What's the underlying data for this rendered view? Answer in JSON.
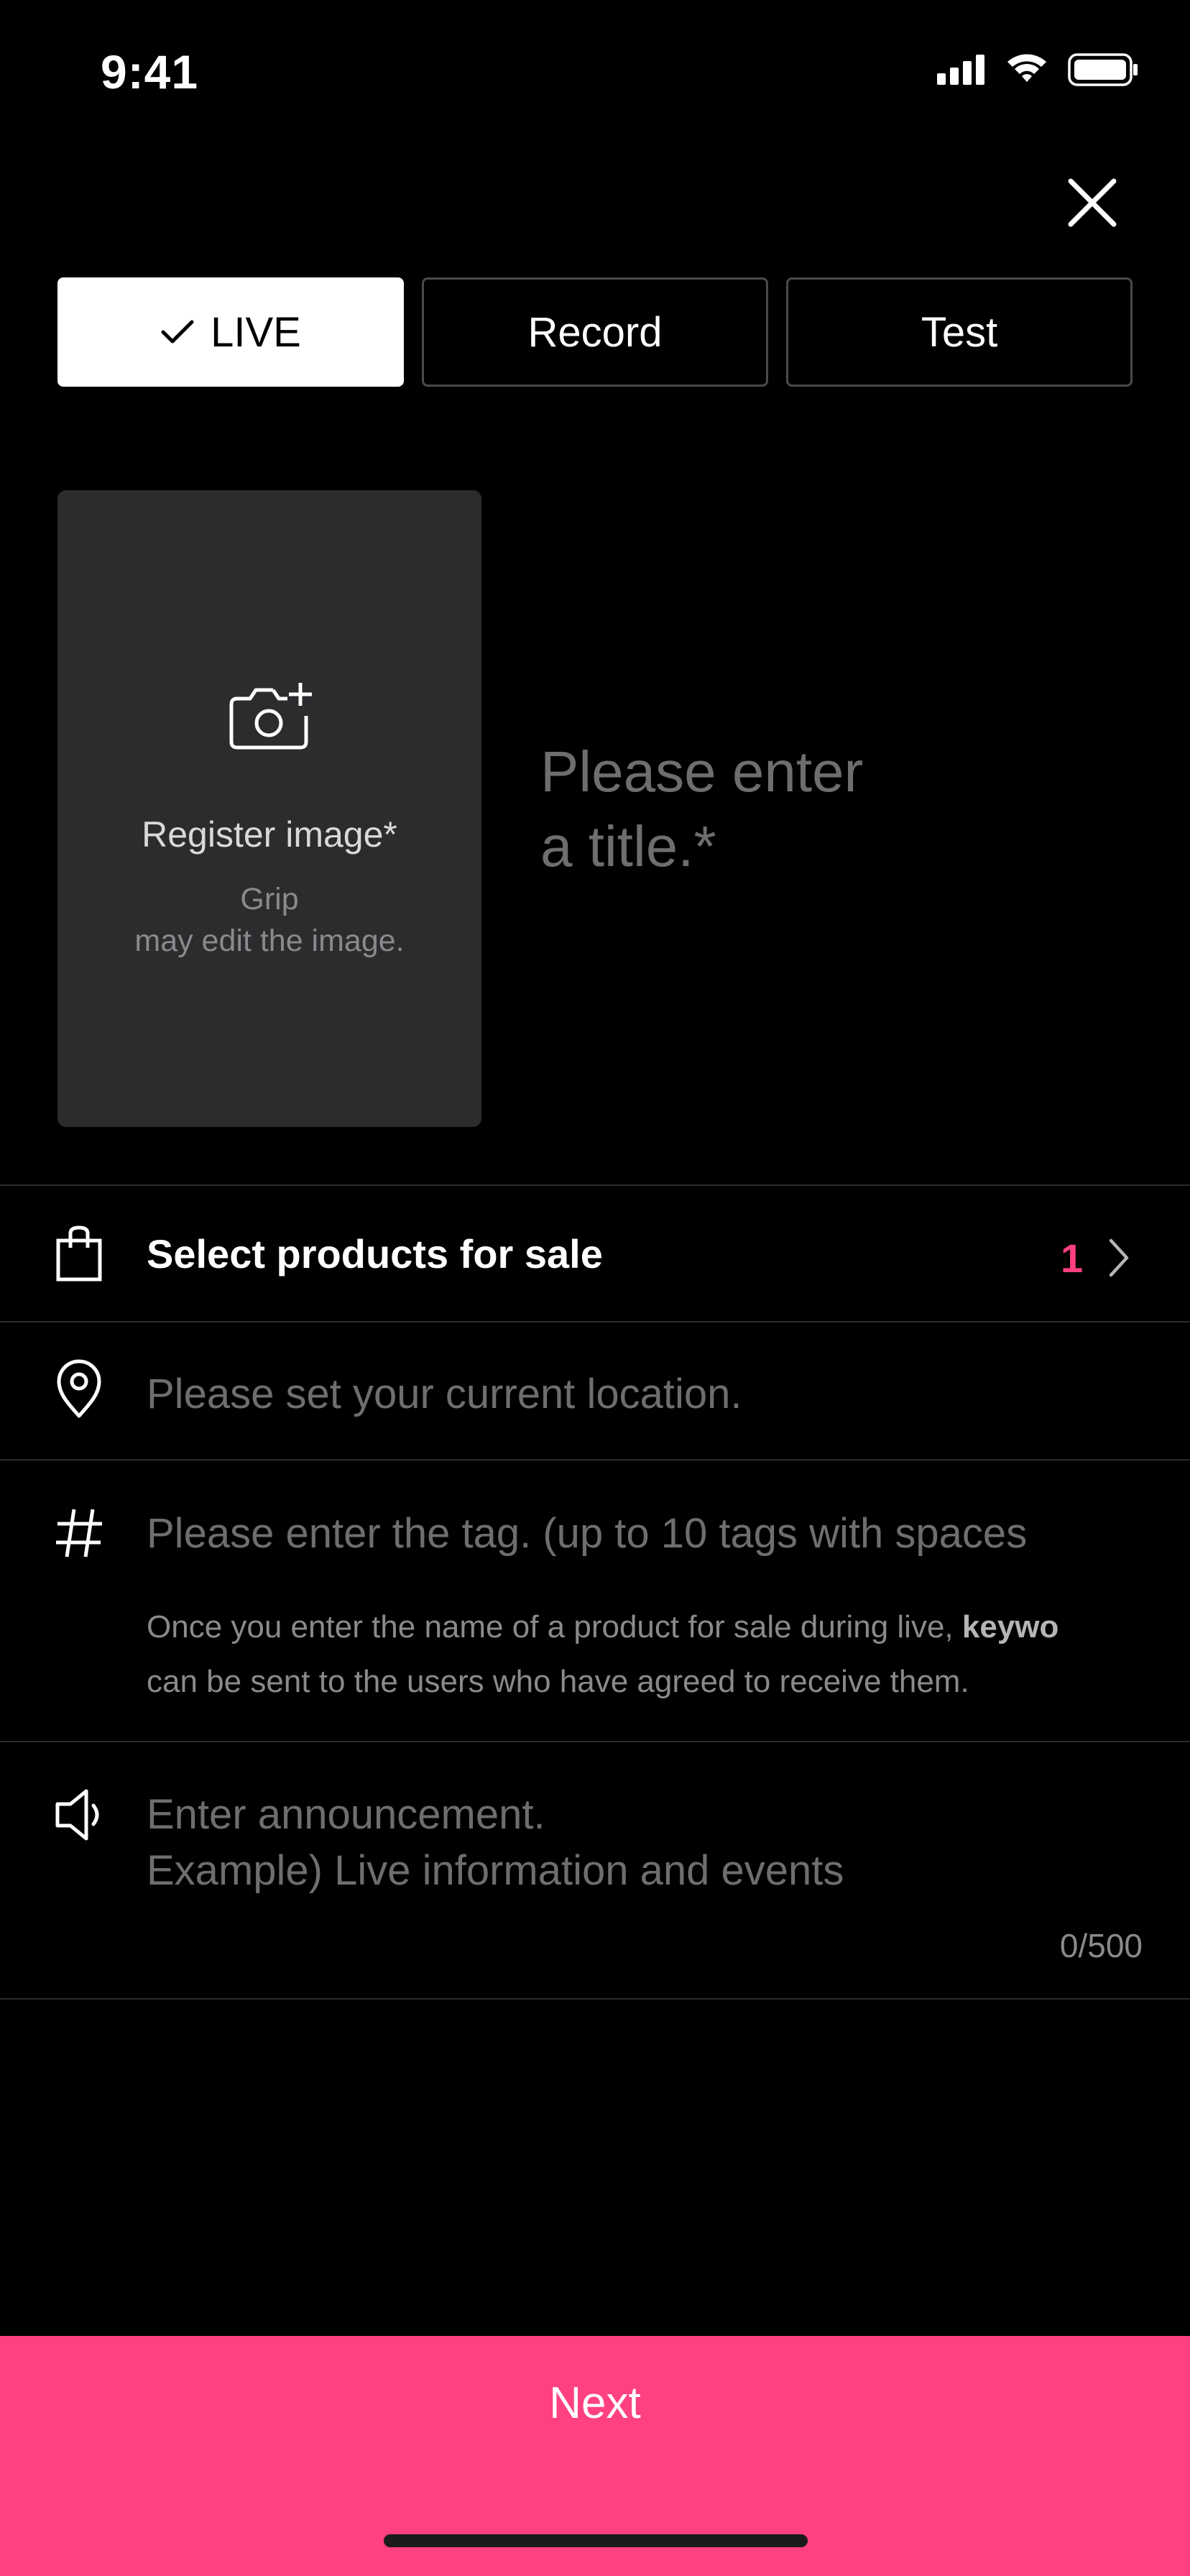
{
  "status_bar": {
    "time": "9:41"
  },
  "mode_tabs": [
    {
      "label": "LIVE",
      "selected": true
    },
    {
      "label": "Record",
      "selected": false
    },
    {
      "label": "Test",
      "selected": false
    }
  ],
  "image_upload": {
    "label": "Register image*",
    "hint_line1": "Grip",
    "hint_line2": "may edit the image."
  },
  "title_input": {
    "placeholder": "Please enter a title.*"
  },
  "products_row": {
    "label": "Select products for sale",
    "count": "1"
  },
  "location_row": {
    "placeholder": "Please set your current location."
  },
  "tag_row": {
    "placeholder": "Please enter the tag. (up to 10 tags with spaces",
    "hint_prefix": "Once you enter the name of a product for sale during live, ",
    "hint_bold": "keywo",
    "hint_line2": "can be sent to the users who have agreed to receive them."
  },
  "announcement": {
    "placeholder": "Enter announcement.\nExample) Live information and events",
    "counter": "0/500"
  },
  "next_button": {
    "label": "Next"
  },
  "colors": {
    "accent": "#ff4081",
    "background": "#000000",
    "image_box": "#2c2b2e"
  }
}
